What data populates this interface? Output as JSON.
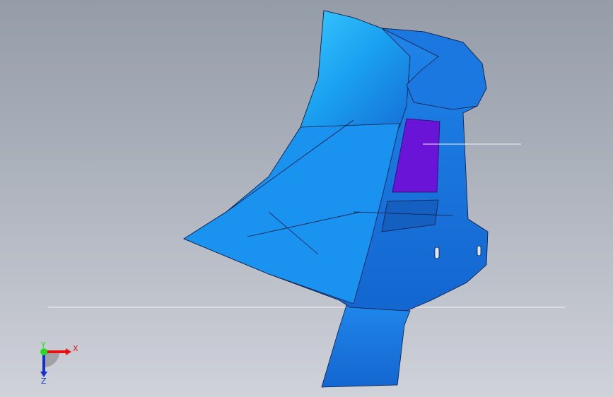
{
  "viewport": {
    "background_top": "#949ca8",
    "background_bottom": "#cfd2d9",
    "part_color": "#1f7fe8",
    "selected_face_color": "#6a14d8"
  },
  "triad": {
    "x_label": "X",
    "y_label": "Y",
    "z_label": "Z",
    "x_color": "#e81010",
    "y_color": "#22dd22",
    "z_color": "#1530c8"
  }
}
